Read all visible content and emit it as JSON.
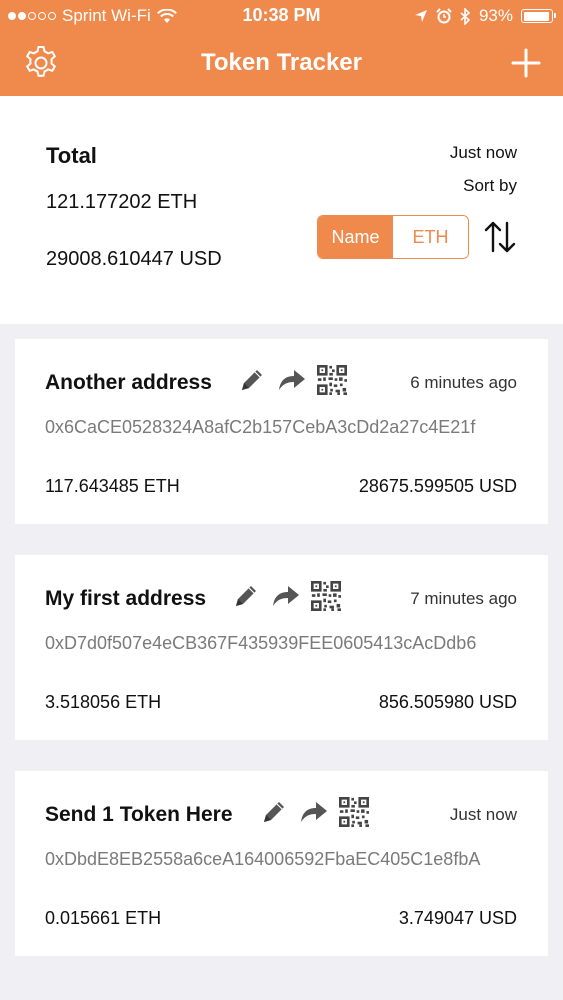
{
  "status_bar": {
    "carrier": "Sprint Wi-Fi",
    "time": "10:38 PM",
    "battery": "93%",
    "battery_level": 0.93,
    "icons": [
      "signal-dots-icon",
      "wifi-icon",
      "location-icon",
      "alarm-icon",
      "bluetooth-icon",
      "battery-icon"
    ]
  },
  "nav": {
    "title": "Token Tracker",
    "left_icon": "gear-icon",
    "right_icon": "plus-icon"
  },
  "summary": {
    "label": "Total",
    "eth": "121.177202 ETH",
    "usd": "29008.610447 USD",
    "updated": "Just now",
    "sort_label": "Sort by",
    "sort_options": [
      "Name",
      "ETH"
    ],
    "sort_selected": "Name",
    "sort_icon": "sort-arrows-icon"
  },
  "colors": {
    "accent": "#f0894c",
    "background": "#efeff4",
    "address_text": "#7a7a7a"
  },
  "accounts": [
    {
      "name": "Another address",
      "time": "6 minutes ago",
      "address": "0x6CaCE0528324A8afC2b157CebA3cDd2a27c4E21f",
      "eth": "117.643485 ETH",
      "usd": "28675.599505 USD"
    },
    {
      "name": "My first address",
      "time": "7 minutes ago",
      "address": "0xD7d0f507e4eCB367F435939FEE0605413cAcDdb6",
      "eth": "3.518056 ETH",
      "usd": "856.505980 USD"
    },
    {
      "name": "Send 1 Token Here",
      "time": "Just now",
      "address": "0xDbdE8EB2558a6ceA164006592FbaEC405C1e8fbA",
      "eth": "0.015661 ETH",
      "usd": "3.749047 USD"
    }
  ]
}
